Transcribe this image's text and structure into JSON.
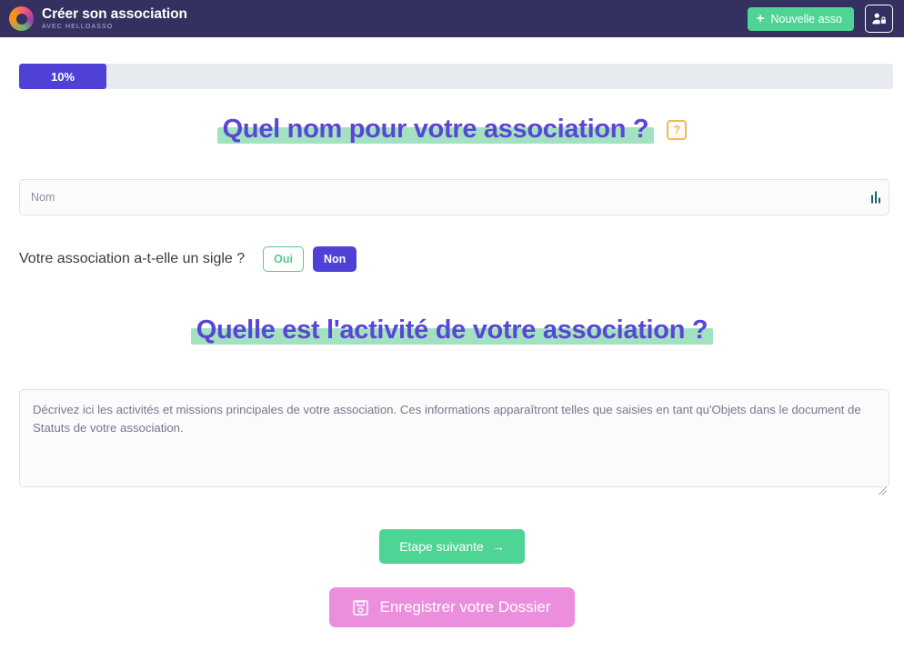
{
  "header": {
    "brand_title": "Créer son association",
    "brand_subtitle": "AVEC HELLOASSO",
    "logo_icon": "helloasso-ring-logo",
    "new_asso_label": "Nouvelle asso",
    "new_asso_plus": "+",
    "account_icon": "user-lock-icon",
    "bg_color": "#343161",
    "accent_green": "#4ed494"
  },
  "progress": {
    "label": "10%",
    "percent": 10,
    "fill_color": "#4f40d6",
    "track_color": "#e7eaee"
  },
  "section_name": {
    "heading": "Quel nom pour votre association ?",
    "highlight_color": "#a3e2c0",
    "heading_color": "#5a46d6",
    "help_label": "?",
    "help_color": "#f5b955",
    "input_placeholder": "Nom",
    "input_value": "",
    "input_badge_icon": "writing-assistant-icon"
  },
  "section_sigle": {
    "question": "Votre association a-t-elle un sigle ?",
    "option_yes": "Oui",
    "option_no": "Non",
    "selected": "Non",
    "yes_color": "#59c98c",
    "no_color": "#4f40d6"
  },
  "section_activity": {
    "heading": "Quelle est l'activité de votre association ?",
    "textarea_placeholder": "Décrivez ici les activités et missions principales de votre association. Ces informations apparaîtront telles que saisies en tant qu'Objets dans le document de Statuts de votre association.",
    "textarea_value": ""
  },
  "actions": {
    "next_label": "Etape suivante",
    "next_arrow": "→",
    "next_color": "#4ed494",
    "save_label": "Enregistrer votre Dossier",
    "save_icon": "floppy-disk-save-icon",
    "save_color": "#ec8ede"
  }
}
